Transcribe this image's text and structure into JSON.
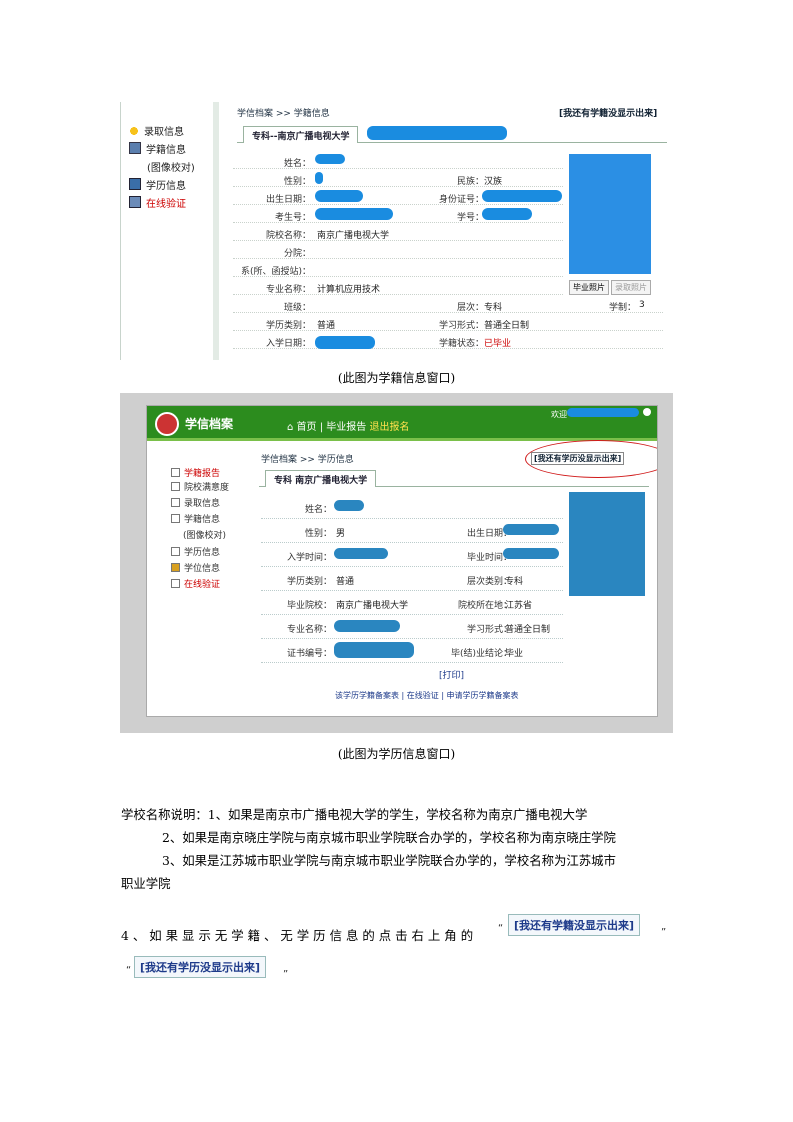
{
  "shot1": {
    "sidebar": [
      {
        "label": "录取信息",
        "icon": "award-icon",
        "red": false
      },
      {
        "label": "学籍信息",
        "icon": "document-icon",
        "red": false
      },
      {
        "label": "(图像校对)",
        "icon": "",
        "red": false
      },
      {
        "label": "学历信息",
        "icon": "certificate-icon",
        "red": false
      },
      {
        "label": "在线验证",
        "icon": "verify-icon",
        "red": true
      }
    ],
    "breadcrumb": "学信档案 >> 学籍信息",
    "right_link": "[我还有学籍没显示出来]",
    "tab_label": "专科--南京广播电视大学",
    "labels": {
      "name": "姓名：",
      "gender": "性别：",
      "birth": "出生日期：",
      "exam_no": "考生号：",
      "school": "院校名称：",
      "branch": "分院：",
      "dept": "系(所、函授站)：",
      "major": "专业名称：",
      "class": "班级：",
      "form": "学历类别：",
      "entry": "入学日期：",
      "nation": "民族：",
      "id": "身份证号：",
      "student_no": "学号：",
      "level": "层次：",
      "study_form": "学习形式：",
      "status": "学籍状态：",
      "duration": "学制："
    },
    "values": {
      "nation": "汉族",
      "school": "南京广播电视大学",
      "major": "计算机应用技术",
      "level": "专科",
      "form": "普通",
      "study_form": "普通全日制",
      "status": "已毕业",
      "duration": "3"
    },
    "buttons": [
      "毕业照片",
      "录取照片"
    ]
  },
  "shot2": {
    "title": "学信档案",
    "top_nav": {
      "home": "首页",
      "sep": "|",
      "item": "毕业报告",
      "register": "退出报名"
    },
    "top_right": "欢迎",
    "sidebar": [
      {
        "label": "学籍报告",
        "red": true
      },
      {
        "label": "院校满意度",
        "red": false
      },
      {
        "label": "录取信息",
        "red": false
      },
      {
        "label": "学籍信息",
        "red": false
      },
      {
        "label": "(图像校对)",
        "red": false
      },
      {
        "label": "学历信息",
        "red": false
      },
      {
        "label": "学位信息",
        "red": false
      },
      {
        "label": "在线验证",
        "red": true
      }
    ],
    "breadcrumb": "学信档案 >> 学历信息",
    "right_link": "[我还有学历没显示出来]",
    "tab_label": "专科  南京广播电视大学",
    "labels": {
      "name": "姓名：",
      "gender": "性别：",
      "entry": "入学时间：",
      "form": "学历类别：",
      "school": "毕业院校：",
      "major": "专业名称：",
      "cert": "证书编号：",
      "birth": "出生日期：",
      "grad": "毕业时间：",
      "level": "层次类别：",
      "location": "院校所在地：",
      "study_form": "学习形式：",
      "result": "毕(结)业结论："
    },
    "values": {
      "gender": "男",
      "form": "普通",
      "level": "专科",
      "school": "南京广播电视大学",
      "location": "江苏省",
      "study_form": "普通全日制",
      "result": "毕业"
    },
    "print": "[打印]",
    "bottom_links": "该学历学籍备案表  |  在线验证  |  申请学历学籍备案表"
  },
  "captions": {
    "c1": "(此图为学籍信息窗口)",
    "c2": "(此图为学历信息窗口)"
  },
  "paragraph": {
    "l1": "学校名称说明：1、如果是南京市广播电视大学的学生，学校名称为南京广播电视大学",
    "l2": "2、如果是南京晓庄学院与南京城市职业学院联合办学的，学校名称为南京晓庄学院",
    "l3": "3、如果是江苏城市职业学院与南京城市职业学院联合办学的，学校名称为江苏城市",
    "l4": "职业学院",
    "l5": "4、如果显示无学籍、无学历信息的点击右上角的",
    "btn_xueji": "[我还有学籍没显示出来]",
    "btn_xueli": "[我还有学历没显示出来]",
    "lq": "“",
    "rq": "”"
  }
}
